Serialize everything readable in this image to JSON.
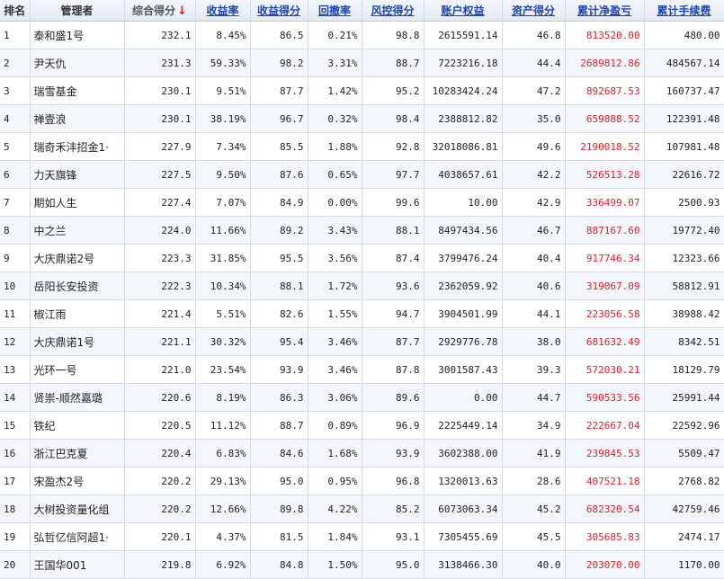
{
  "headers": [
    {
      "label": "排名",
      "link": false
    },
    {
      "label": "管理者",
      "link": false
    },
    {
      "label": "综合得分",
      "link": false,
      "sorted": true
    },
    {
      "label": "收益率",
      "link": true
    },
    {
      "label": "收益得分",
      "link": true
    },
    {
      "label": "回撤率",
      "link": true
    },
    {
      "label": "风控得分",
      "link": true
    },
    {
      "label": "账户权益",
      "link": true
    },
    {
      "label": "资产得分",
      "link": true
    },
    {
      "label": "累计净盈亏",
      "link": true
    },
    {
      "label": "累计手续费",
      "link": true
    }
  ],
  "sort_arrow": "↓",
  "accent_color": "#e0202a",
  "link_color": "#1a46b4",
  "rows": [
    [
      "1",
      "泰和盛1号",
      "232.1",
      "8.45%",
      "86.5",
      "0.21%",
      "98.8",
      "2615591.14",
      "46.8",
      "813520.00",
      "480.00"
    ],
    [
      "2",
      "尹天仇",
      "231.3",
      "59.33%",
      "98.2",
      "3.31%",
      "88.7",
      "7223216.18",
      "44.4",
      "2689812.86",
      "484567.14"
    ],
    [
      "3",
      "瑞雪基金",
      "230.1",
      "9.51%",
      "87.7",
      "1.42%",
      "95.2",
      "10283424.24",
      "47.2",
      "892687.53",
      "160737.47"
    ],
    [
      "4",
      "禅壹浪",
      "230.1",
      "38.19%",
      "96.7",
      "0.32%",
      "98.4",
      "2388812.82",
      "35.0",
      "659888.52",
      "122391.48"
    ],
    [
      "5",
      "瑞奇禾沣招金1·",
      "227.9",
      "7.34%",
      "85.5",
      "1.88%",
      "92.8",
      "32018086.81",
      "49.6",
      "2190018.52",
      "107981.48"
    ],
    [
      "6",
      "力天旗锋",
      "227.5",
      "9.50%",
      "87.6",
      "0.65%",
      "97.7",
      "4038657.61",
      "42.2",
      "526513.28",
      "22616.72"
    ],
    [
      "7",
      "期如人生",
      "227.4",
      "7.07%",
      "84.9",
      "0.00%",
      "99.6",
      "10.00",
      "42.9",
      "336499.07",
      "2500.93"
    ],
    [
      "8",
      "中之兰",
      "224.0",
      "11.66%",
      "89.2",
      "3.43%",
      "88.1",
      "8497434.56",
      "46.7",
      "887167.60",
      "19772.40"
    ],
    [
      "9",
      "大庆鼎诺2号",
      "223.3",
      "31.85%",
      "95.5",
      "3.56%",
      "87.4",
      "3799476.24",
      "40.4",
      "917746.34",
      "12323.66"
    ],
    [
      "10",
      "岳阳长安投资",
      "222.3",
      "10.34%",
      "88.1",
      "1.72%",
      "93.6",
      "2362059.92",
      "40.6",
      "319067.09",
      "58812.91"
    ],
    [
      "11",
      "椒江雨",
      "221.4",
      "5.51%",
      "82.6",
      "1.55%",
      "94.7",
      "3904501.99",
      "44.1",
      "223056.58",
      "38988.42"
    ],
    [
      "12",
      "大庆鼎诺1号",
      "221.1",
      "30.32%",
      "95.4",
      "3.46%",
      "87.7",
      "2929776.78",
      "38.0",
      "681632.49",
      "8342.51"
    ],
    [
      "13",
      "光环一号",
      "221.0",
      "23.54%",
      "93.9",
      "3.46%",
      "87.8",
      "3001587.43",
      "39.3",
      "572030.21",
      "18129.79"
    ],
    [
      "14",
      "贤崇-顺然嘉璐",
      "220.6",
      "8.19%",
      "86.3",
      "3.06%",
      "89.6",
      "0.00",
      "44.7",
      "590533.56",
      "25991.44"
    ],
    [
      "15",
      "铁纪",
      "220.5",
      "11.12%",
      "88.7",
      "0.89%",
      "96.9",
      "2225449.14",
      "34.9",
      "222667.04",
      "22592.96"
    ],
    [
      "16",
      "浙江巴克夏",
      "220.4",
      "6.83%",
      "84.6",
      "1.68%",
      "93.9",
      "3602388.00",
      "41.9",
      "239845.53",
      "5509.47"
    ],
    [
      "17",
      "宋盈杰2号",
      "220.2",
      "29.13%",
      "95.0",
      "0.95%",
      "96.8",
      "1320013.63",
      "28.6",
      "407521.18",
      "2768.82"
    ],
    [
      "18",
      "大树投资量化组",
      "220.2",
      "12.66%",
      "89.8",
      "4.22%",
      "85.2",
      "6073063.34",
      "45.2",
      "682320.54",
      "42759.46"
    ],
    [
      "19",
      "弘哲亿信阿超1·",
      "220.1",
      "4.37%",
      "81.5",
      "1.84%",
      "93.1",
      "7305455.69",
      "45.5",
      "305685.83",
      "2474.17"
    ],
    [
      "20",
      "王国华001",
      "219.8",
      "6.92%",
      "84.8",
      "1.50%",
      "95.0",
      "3138466.30",
      "40.0",
      "203070.00",
      "1170.00"
    ]
  ]
}
